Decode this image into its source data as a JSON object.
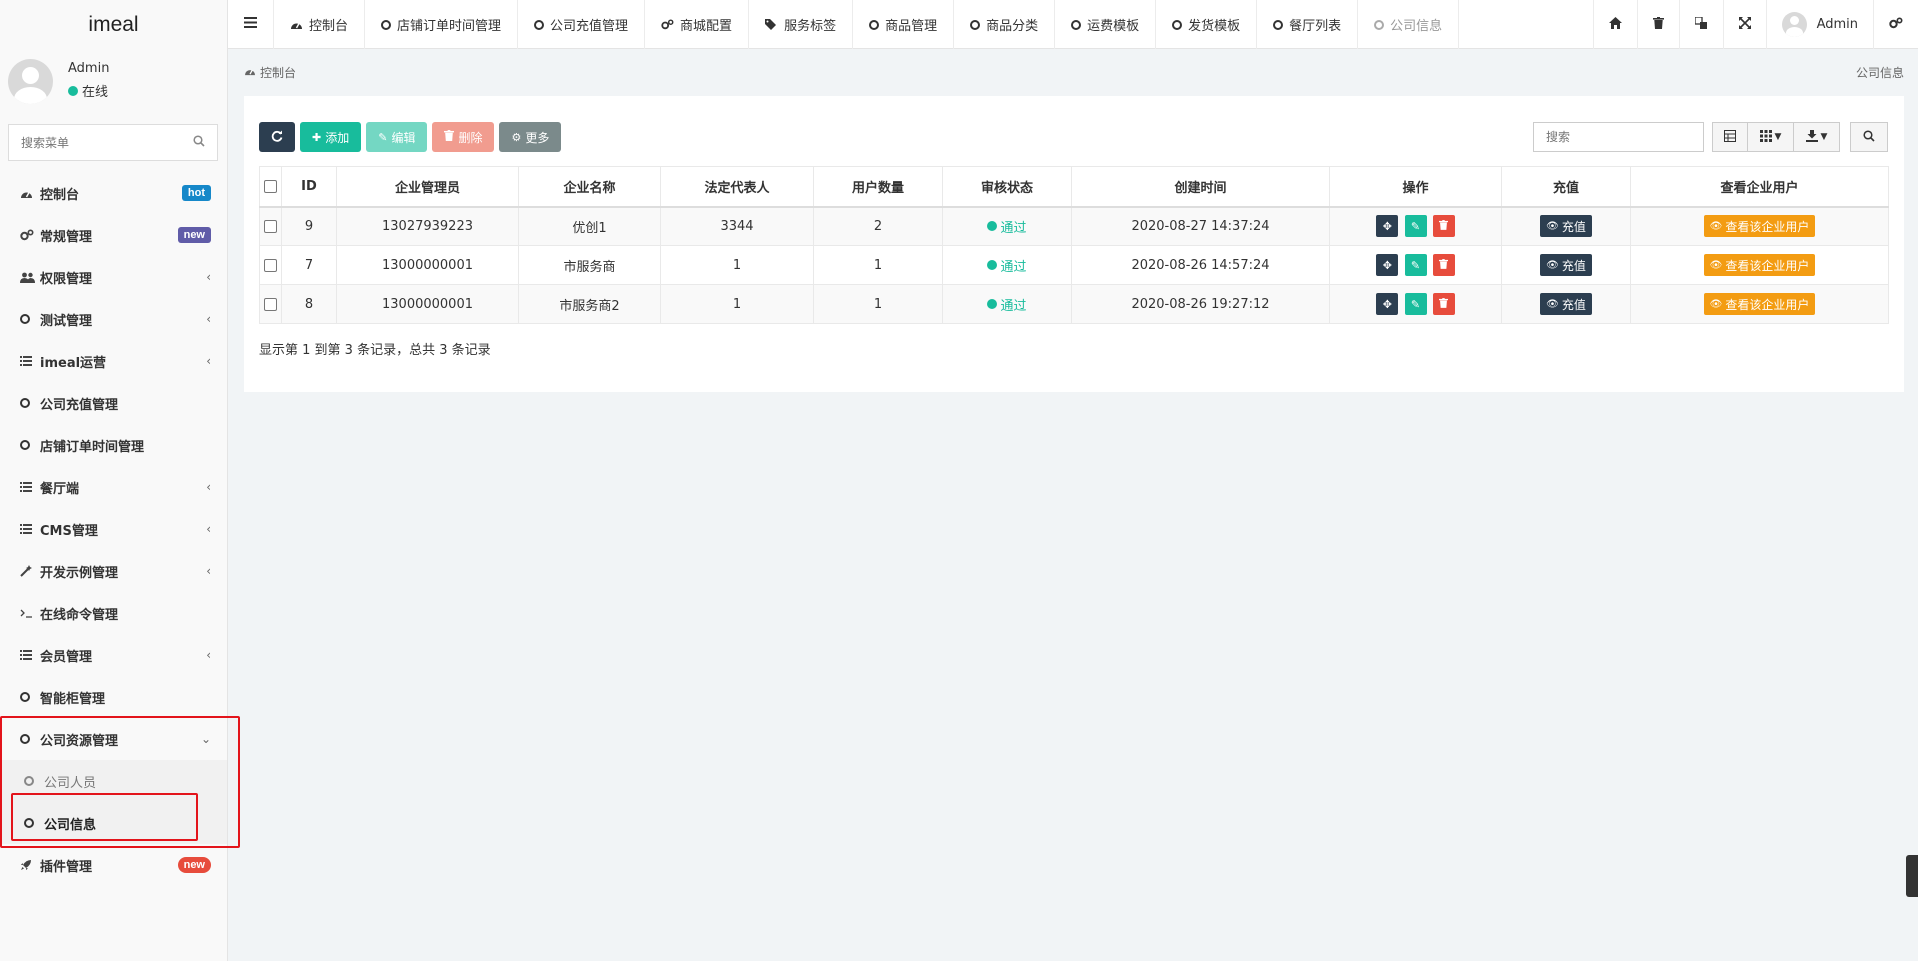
{
  "sidebar": {
    "logo": "imeal",
    "user": {
      "name": "Admin",
      "status": "在线"
    },
    "search_placeholder": "搜索菜单",
    "items": [
      {
        "label": "控制台",
        "badge": "hot"
      },
      {
        "label": "常规管理",
        "badge": "new"
      },
      {
        "label": "权限管理"
      },
      {
        "label": "测试管理"
      },
      {
        "label": "imeal运营"
      },
      {
        "label": "公司充值管理"
      },
      {
        "label": "店铺订单时间管理"
      },
      {
        "label": "餐厅端"
      },
      {
        "label": "CMS管理"
      },
      {
        "label": "开发示例管理"
      },
      {
        "label": "在线命令管理"
      },
      {
        "label": "会员管理"
      },
      {
        "label": "智能柜管理"
      },
      {
        "label": "公司资源管理"
      },
      {
        "label": "公司人员"
      },
      {
        "label": "公司信息"
      },
      {
        "label": "插件管理",
        "badge": "new"
      }
    ]
  },
  "topnav": {
    "tabs": [
      {
        "label": "控制台"
      },
      {
        "label": "店铺订单时间管理"
      },
      {
        "label": "公司充值管理"
      },
      {
        "label": "商城配置"
      },
      {
        "label": "服务标签"
      },
      {
        "label": "商品管理"
      },
      {
        "label": "商品分类"
      },
      {
        "label": "运费模板"
      },
      {
        "label": "发货模板"
      },
      {
        "label": "餐厅列表"
      },
      {
        "label": "公司信息"
      }
    ],
    "admin": "Admin"
  },
  "breadcrumb": {
    "label": "控制台",
    "page_title": "公司信息"
  },
  "toolbar": {
    "add": "添加",
    "edit": "编辑",
    "delete": "删除",
    "more": "更多",
    "search_placeholder": "搜索"
  },
  "table": {
    "headers": [
      "ID",
      "企业管理员",
      "企业名称",
      "法定代表人",
      "用户数量",
      "审核状态",
      "创建时间",
      "操作",
      "充值",
      "查看企业用户"
    ],
    "rows": [
      {
        "id": "9",
        "admin": "13027939223",
        "name": "优创1",
        "legal": "3344",
        "users": "2",
        "status": "通过",
        "created": "2020-08-27 14:37:24",
        "recharge": "充值",
        "view": "查看该企业用户"
      },
      {
        "id": "7",
        "admin": "13000000001",
        "name": "市服务商",
        "legal": "1",
        "users": "1",
        "status": "通过",
        "created": "2020-08-26 14:57:24",
        "recharge": "充值",
        "view": "查看该企业用户"
      },
      {
        "id": "8",
        "admin": "13000000001",
        "name": "市服务商2",
        "legal": "1",
        "users": "1",
        "status": "通过",
        "created": "2020-08-26 19:27:12",
        "recharge": "充值",
        "view": "查看该企业用户"
      }
    ],
    "footer": "显示第 1 到第 3 条记录，总共 3 条记录"
  },
  "colors": {
    "accent_green": "#18bc9c",
    "dark": "#2c3e50",
    "danger": "#e74c3c",
    "warning": "#f39c12",
    "highlight_red": "#e3141b"
  }
}
